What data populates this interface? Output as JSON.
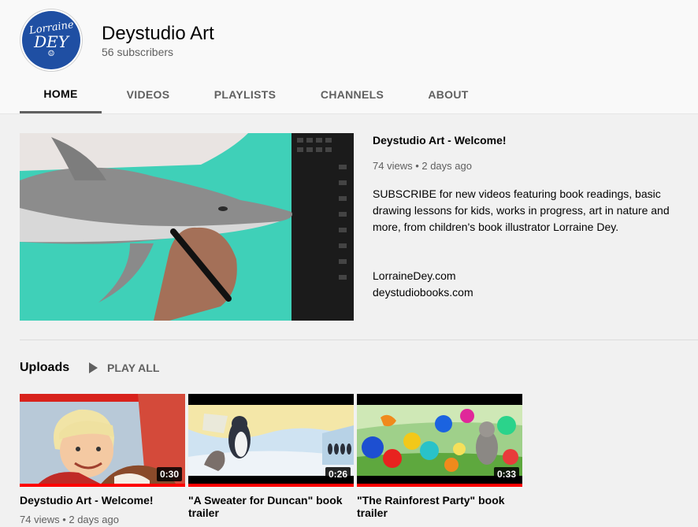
{
  "channel": {
    "avatar_text": [
      "Lorraine",
      "DEY",
      "☺"
    ],
    "name": "Deystudio Art",
    "subscribers": "56 subscribers"
  },
  "tabs": [
    {
      "label": "HOME",
      "active": true
    },
    {
      "label": "VIDEOS",
      "active": false
    },
    {
      "label": "PLAYLISTS",
      "active": false
    },
    {
      "label": "CHANNELS",
      "active": false
    },
    {
      "label": "ABOUT",
      "active": false
    }
  ],
  "featured": {
    "title": "Deystudio Art - Welcome!",
    "views": "74 views",
    "age": "2 days ago",
    "description": "SUBSCRIBE for new videos featuring book readings, basic drawing lessons for kids, works in progress, art in nature and more, from children's book illustrator Lorraine Dey.",
    "links": [
      "LorraineDey.com",
      "deystudiobooks.com"
    ]
  },
  "uploads": {
    "title": "Uploads",
    "play_all": "PLAY ALL",
    "videos": [
      {
        "title": "Deystudio Art - Welcome!",
        "duration": "0:30",
        "views": "74 views",
        "age": "2 days ago",
        "watched_fraction": 1.0
      },
      {
        "title": "\"A Sweater for Duncan\" book trailer",
        "duration": "0:26",
        "watched_fraction": 1.0
      },
      {
        "title": "\"The Rainforest Party\" book trailer",
        "duration": "0:33",
        "watched_fraction": 1.0
      }
    ]
  },
  "colors": {
    "accent_red": "#ff0000",
    "avatar_blue": "#1f4fa3",
    "muted_text": "#606060"
  }
}
